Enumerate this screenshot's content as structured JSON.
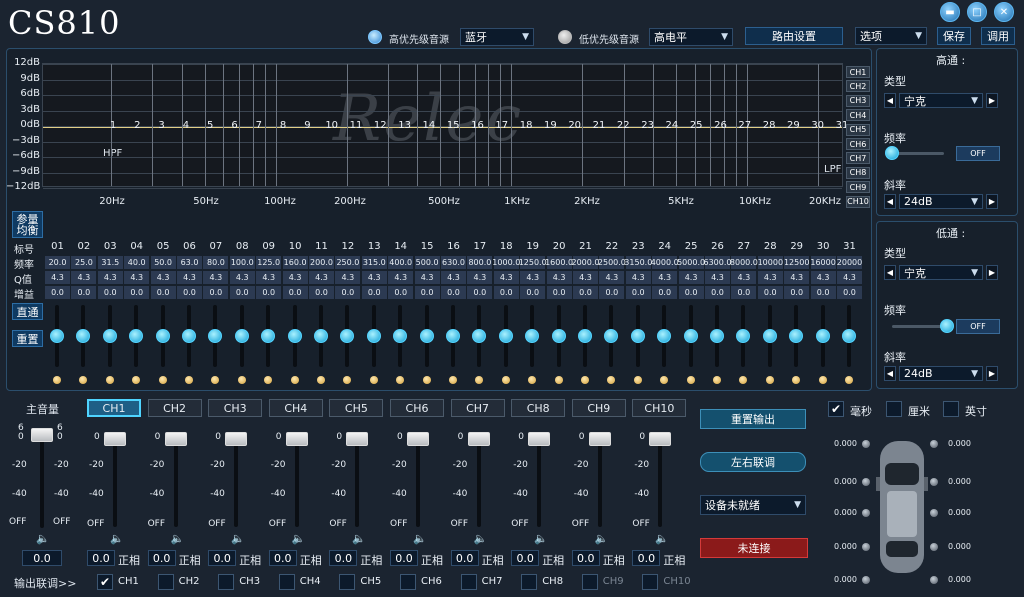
{
  "app": {
    "title": "CS810",
    "min_icon": "minimize-icon",
    "max_icon": "maximize-icon",
    "close_icon": "close-icon"
  },
  "header": {
    "high_priority_label": "高优先级音源",
    "high_priority_value": "蓝牙",
    "low_priority_label": "低优先级音源",
    "low_priority_value": "高电平",
    "routing_button": "路由设置",
    "options_button": "选项",
    "save_button": "保存",
    "tune_button": "调用"
  },
  "graph": {
    "y_labels": [
      "12dB",
      "9dB",
      "6dB",
      "3dB",
      "0dB",
      "−3dB",
      "−6dB",
      "−9dB",
      "−12dB"
    ],
    "x_labels": [
      "20Hz",
      "50Hz",
      "100Hz",
      "200Hz",
      "500Hz",
      "1KHz",
      "2KHz",
      "5KHz",
      "10KHz",
      "20KHz"
    ],
    "points": [
      "1",
      "2",
      "3",
      "4",
      "5",
      "6",
      "7",
      "8",
      "9",
      "10",
      "11",
      "12",
      "13",
      "14",
      "15",
      "16",
      "17",
      "18",
      "19",
      "20",
      "21",
      "22",
      "23",
      "24",
      "25",
      "26",
      "27",
      "28",
      "29",
      "30",
      "31"
    ],
    "hpf_label": "HPF",
    "lpf_label": "LPF",
    "ch_tabs": [
      "CH1",
      "CH2",
      "CH3",
      "CH4",
      "CH5",
      "CH6",
      "CH7",
      "CH8",
      "CH9",
      "CH10"
    ],
    "watermark": "Relec"
  },
  "eq": {
    "param_eq_button": "参量\n均衡",
    "bypass_button": "直通",
    "reset_button": "重置",
    "row_labels": [
      "标号",
      "频率",
      "Q值",
      "增益"
    ],
    "bands": [
      "01",
      "02",
      "03",
      "04",
      "05",
      "06",
      "07",
      "08",
      "09",
      "10",
      "11",
      "12",
      "13",
      "14",
      "15",
      "16",
      "17",
      "18",
      "19",
      "20",
      "21",
      "22",
      "23",
      "24",
      "25",
      "26",
      "27",
      "28",
      "29",
      "30",
      "31"
    ],
    "freqs": [
      "20.0",
      "25.0",
      "31.5",
      "40.0",
      "50.0",
      "63.0",
      "80.0",
      "100.0",
      "125.0",
      "160.0",
      "200.0",
      "250.0",
      "315.0",
      "400.0",
      "500.0",
      "630.0",
      "800.0",
      "1000.0",
      "1250.0",
      "1600.0",
      "2000.0",
      "2500.0",
      "3150.0",
      "4000.0",
      "5000.0",
      "6300.0",
      "8000.0",
      "10000",
      "12500",
      "16000",
      "20000"
    ],
    "q": [
      "4.3",
      "4.3",
      "4.3",
      "4.3",
      "4.3",
      "4.3",
      "4.3",
      "4.3",
      "4.3",
      "4.3",
      "4.3",
      "4.3",
      "4.3",
      "4.3",
      "4.3",
      "4.3",
      "4.3",
      "4.3",
      "4.3",
      "4.3",
      "4.3",
      "4.3",
      "4.3",
      "4.3",
      "4.3",
      "4.3",
      "4.3",
      "4.3",
      "4.3",
      "4.3",
      "4.3"
    ],
    "gain": [
      "0.0",
      "0.0",
      "0.0",
      "0.0",
      "0.0",
      "0.0",
      "0.0",
      "0.0",
      "0.0",
      "0.0",
      "0.0",
      "0.0",
      "0.0",
      "0.0",
      "0.0",
      "0.0",
      "0.0",
      "0.0",
      "0.0",
      "0.0",
      "0.0",
      "0.0",
      "0.0",
      "0.0",
      "0.0",
      "0.0",
      "0.0",
      "0.0",
      "0.0",
      "0.0",
      "0.0"
    ]
  },
  "highpass": {
    "title": "高通 :",
    "type_label": "类型",
    "type_value": "宁克",
    "freq_label": "频率",
    "freq_button": "OFF",
    "slope_label": "斜率",
    "slope_value": "24dB"
  },
  "lowpass": {
    "title": "低通 :",
    "type_label": "类型",
    "type_value": "宁克",
    "freq_label": "频率",
    "freq_button": "OFF",
    "slope_label": "斜率",
    "slope_value": "24dB"
  },
  "master": {
    "label": "主音量",
    "top_left": "6",
    "top_left2": "0",
    "top_right": "6",
    "top_right2": "0",
    "m20": "-20",
    "m40": "-40",
    "off": "OFF",
    "value": "0.0"
  },
  "channels": {
    "names": [
      "CH1",
      "CH2",
      "CH3",
      "CH4",
      "CH5",
      "CH6",
      "CH7",
      "CH8",
      "CH9",
      "CH10"
    ],
    "active": "CH1",
    "top": "0",
    "m20": "-20",
    "m40": "-40",
    "off": "OFF",
    "value": "0.0",
    "phase": "正相"
  },
  "controls": {
    "reset_output": "重置输出",
    "lr_link": "左右联调",
    "device_status": "设备未就绪",
    "connect": "未连接"
  },
  "units": {
    "ms": "毫秒",
    "cm": "厘米",
    "inch": "英寸"
  },
  "delays": {
    "values": [
      "0.000",
      "0.000",
      "0.000",
      "0.000",
      "0.000",
      "0.000",
      "0.000",
      "0.000",
      "0.000",
      "0.000"
    ]
  },
  "link": {
    "label": "输出联调>>",
    "channels": [
      "CH1",
      "CH2",
      "CH3",
      "CH4",
      "CH5",
      "CH6",
      "CH7",
      "CH8",
      "CH9",
      "CH10"
    ]
  }
}
